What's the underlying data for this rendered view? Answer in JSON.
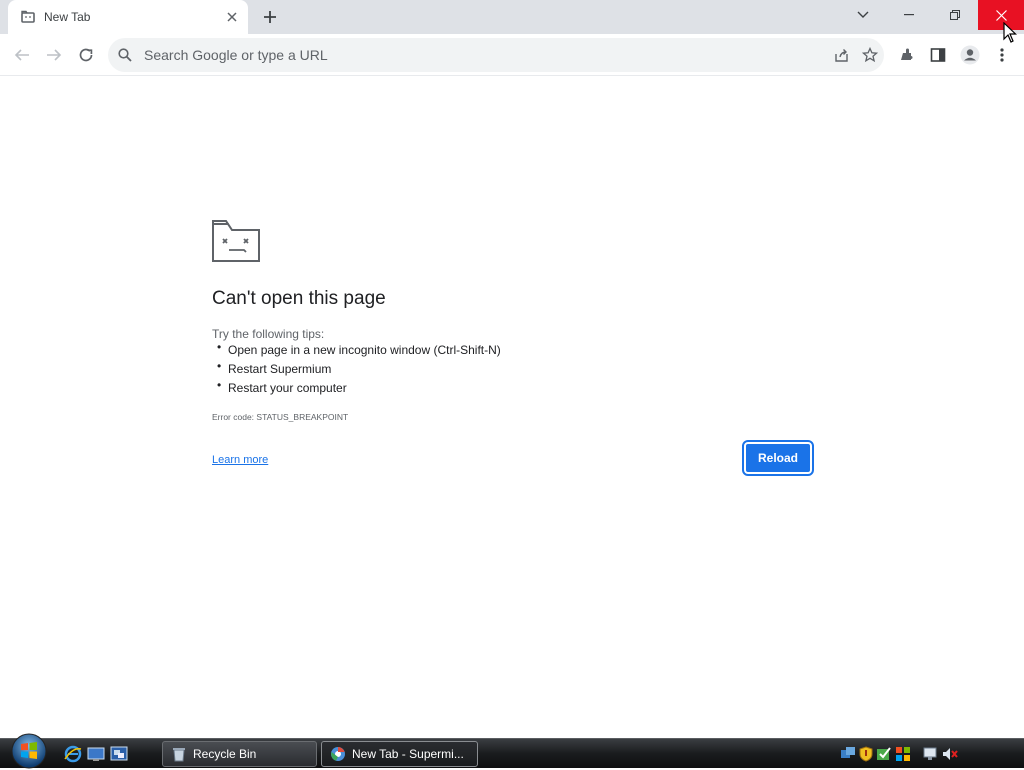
{
  "browser": {
    "tab_title": "New Tab",
    "omnibox_placeholder": "Search Google or type a URL"
  },
  "error_page": {
    "title": "Can't open this page",
    "tips_heading": "Try the following tips:",
    "tips": [
      "Open page in a new incognito window (Ctrl-Shift-N)",
      "Restart Supermium",
      "Restart your computer"
    ],
    "error_code": "Error code: STATUS_BREAKPOINT",
    "learn_more": "Learn more",
    "reload_label": "Reload"
  },
  "taskbar": {
    "buttons": [
      {
        "label": "Recycle Bin"
      },
      {
        "label": "New Tab - Supermi..."
      }
    ]
  },
  "colors": {
    "accent": "#1a73e8",
    "close_button": "#e81123",
    "titlebar": "#dee1e6"
  },
  "icons": [
    "tab-favicon-icon",
    "close-icon",
    "plus-icon",
    "chevron-down-icon",
    "minimize-icon",
    "maximize-icon",
    "back-icon",
    "forward-icon",
    "reload-icon",
    "search-icon",
    "share-icon",
    "star-icon",
    "extensions-icon",
    "side-panel-icon",
    "profile-icon",
    "menu-icon",
    "sad-folder-icon",
    "windows-start-icon"
  ]
}
